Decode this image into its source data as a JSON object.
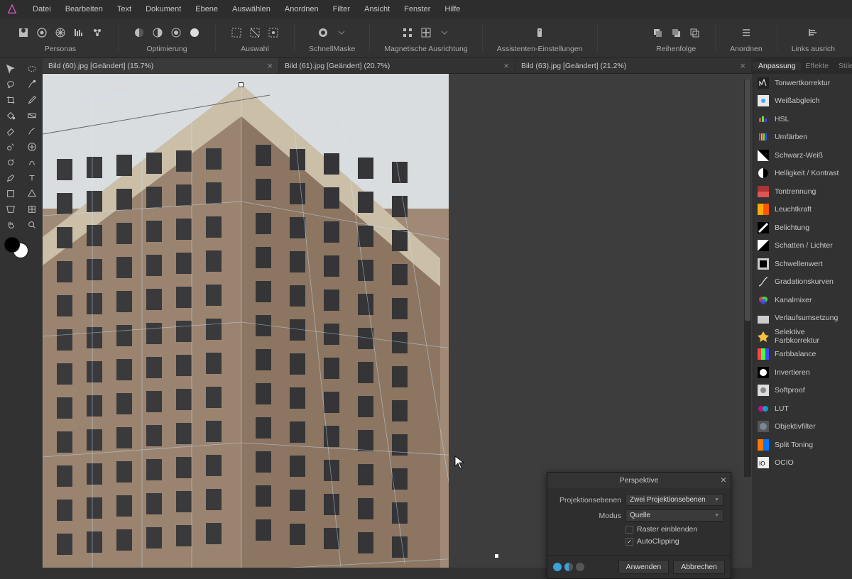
{
  "menu": [
    "Datei",
    "Bearbeiten",
    "Text",
    "Dokument",
    "Ebene",
    "Auswählen",
    "Anordnen",
    "Filter",
    "Ansicht",
    "Fenster",
    "Hilfe"
  ],
  "toolbar": [
    {
      "label": "Personas",
      "icons": [
        "persona-photo",
        "persona-liquefy",
        "persona-develop",
        "persona-tone",
        "persona-export"
      ]
    },
    {
      "label": "Optimierung",
      "icons": [
        "opt-a",
        "opt-b",
        "opt-c",
        "opt-d"
      ]
    },
    {
      "label": "Auswahl",
      "icons": [
        "sel-a",
        "sel-b",
        "sel-c"
      ]
    },
    {
      "label": "SchnellMaske",
      "icons": [
        "mask",
        "drop"
      ]
    },
    {
      "label": "Magnetische Ausrichtung",
      "icons": [
        "snap-a",
        "snap-b",
        "drop"
      ]
    },
    {
      "label": "Assistenten-Einstellungen",
      "icons": [
        "assist"
      ]
    },
    {
      "label": "Reihenfolge",
      "icons": [
        "order-a",
        "order-b",
        "order-c"
      ]
    },
    {
      "label": "Anordnen",
      "icons": [
        "arrange"
      ]
    },
    {
      "label": "Links ausrich",
      "icons": [
        "align"
      ]
    }
  ],
  "doc_tabs": [
    {
      "title": "Bild (60).jpg [Geändert] (15.7%)",
      "active": true
    },
    {
      "title": "Bild (61).jpg [Geändert] (20.7%)",
      "active": false
    },
    {
      "title": "Bild (63).jpg [Geändert] (21.2%)",
      "active": false
    }
  ],
  "right_tabs": [
    "Anpassung",
    "Effekte",
    "Stile"
  ],
  "right_tab_active": 0,
  "adjustments": [
    {
      "label": "Tonwertkorrektur",
      "icon": "levels"
    },
    {
      "label": "Weißabgleich",
      "icon": "wb"
    },
    {
      "label": "HSL",
      "icon": "hsl"
    },
    {
      "label": "Umfärben",
      "icon": "recolor"
    },
    {
      "label": "Schwarz-Weiß",
      "icon": "bw"
    },
    {
      "label": "Helligkeit / Kontrast",
      "icon": "bc"
    },
    {
      "label": "Tontrennung",
      "icon": "posterize"
    },
    {
      "label": "Leuchtkraft",
      "icon": "vibrance"
    },
    {
      "label": "Belichtung",
      "icon": "exposure"
    },
    {
      "label": "Schatten / Lichter",
      "icon": "sh"
    },
    {
      "label": "Schwellenwert",
      "icon": "threshold"
    },
    {
      "label": "Gradationskurven",
      "icon": "curves"
    },
    {
      "label": "Kanalmixer",
      "icon": "channel"
    },
    {
      "label": "Verlaufsumsetzung",
      "icon": "gradmap"
    },
    {
      "label": "Selektive Farbkorrektur",
      "icon": "selcolor"
    },
    {
      "label": "Farbbalance",
      "icon": "colorbal"
    },
    {
      "label": "Invertieren",
      "icon": "invert"
    },
    {
      "label": "Softproof",
      "icon": "softproof"
    },
    {
      "label": "LUT",
      "icon": "lut"
    },
    {
      "label": "Objektivfilter",
      "icon": "lensfilter"
    },
    {
      "label": "Split Toning",
      "icon": "splittone"
    },
    {
      "label": "OCIO",
      "icon": "ocio"
    }
  ],
  "perspective_panel": {
    "title": "Perspektive",
    "proj_label": "Projektionsebenen",
    "proj_value": "Zwei Projektionsebenen",
    "mode_label": "Modus",
    "mode_value": "Quelle",
    "show_grid_label": "Raster einblenden",
    "show_grid_checked": false,
    "autoclip_label": "AutoClipping",
    "autoclip_checked": true,
    "apply": "Anwenden",
    "cancel": "Abbrechen"
  }
}
